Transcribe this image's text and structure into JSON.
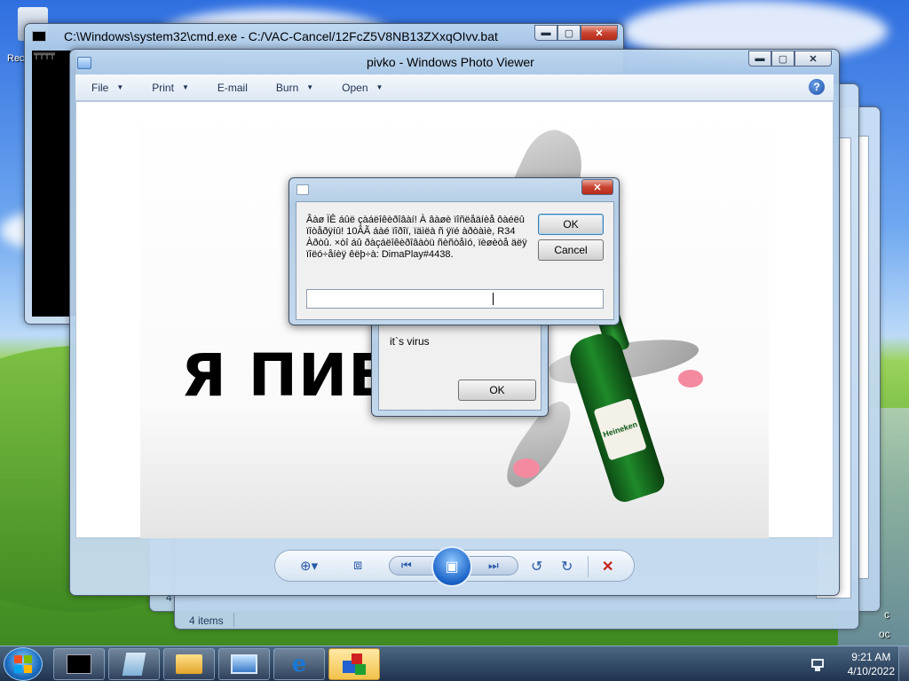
{
  "desktop": {
    "partial_icon_label": "Rec",
    "partial_right_text_1": "c",
    "partial_right_text_2": "oc"
  },
  "background_windows": {
    "items_count_back": "4 items",
    "items_count_front": "4 items"
  },
  "cmd_window": {
    "title": "C:\\Windows\\system32\\cmd.exe - C:/VAC-Cancel/12FcZ5V8NB13ZXxqOIvv.bat",
    "console_text": "╤╤╤╤"
  },
  "photo_viewer": {
    "title": "pivko - Windows Photo Viewer",
    "menu": [
      {
        "label": "File",
        "has_arrow": true
      },
      {
        "label": "Print",
        "has_arrow": true
      },
      {
        "label": "E-mail",
        "has_arrow": false
      },
      {
        "label": "Burn",
        "has_arrow": true
      },
      {
        "label": "Open",
        "has_arrow": true
      }
    ],
    "photo_caption": "Я ПИВ",
    "bottle_label": "Heineken"
  },
  "dialog_main": {
    "message": "Âàø ÏÊ áûë çàáëîêèðîâàí! À âàøè ïîñëåäíèå ôàéëû ïîòåðÿíû! 10ÂÃ áàé ïîðîï, ïäìëà ñ ÿïé àðòàìè, R34 Àðòû. ×òî áû ðàçáëîêèðîâàòü ñèñòåìó, ïèøèòå äëÿ ïîëó÷åíèÿ êëþ÷à: DimaPlay#4438.",
    "ok_label": "OK",
    "cancel_label": "Cancel",
    "input_value": ""
  },
  "dialog_virus": {
    "message": "it`s virus",
    "ok_label": "OK"
  },
  "taskbar": {
    "apps": [
      "cmd",
      "notepad",
      "explorer",
      "photo-viewer",
      "internet-explorer",
      "virus-app"
    ],
    "time": "9:21 AM",
    "date": "4/10/2022"
  },
  "colors": {
    "taskbar": "#1e3a5a",
    "close_button": "#c94331",
    "accent": "#1a63c8"
  }
}
